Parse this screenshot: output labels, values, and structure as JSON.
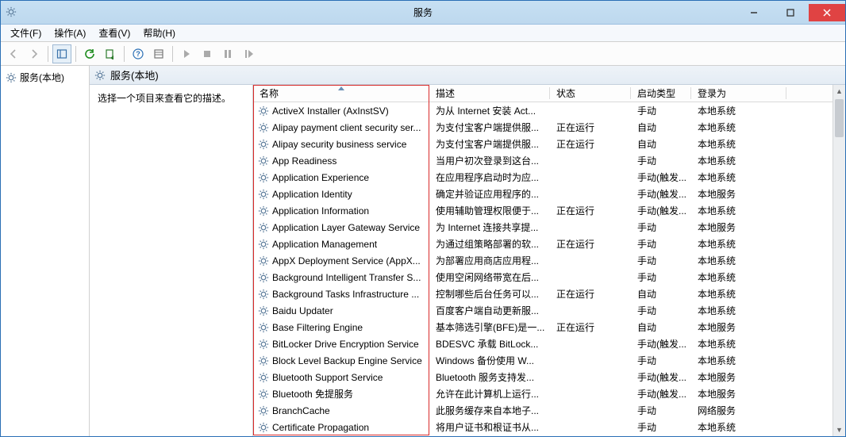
{
  "window": {
    "title": "服务",
    "icon": "gear-icon"
  },
  "menubar": {
    "file": "文件(F)",
    "action": "操作(A)",
    "view": "查看(V)",
    "help": "帮助(H)"
  },
  "tree": {
    "root": "服务(本地)"
  },
  "main": {
    "header": "服务(本地)",
    "desc_prompt": "选择一个项目来查看它的描述。"
  },
  "columns": {
    "name": "名称",
    "desc": "描述",
    "status": "状态",
    "startup": "启动类型",
    "logon": "登录为"
  },
  "col_widths": {
    "name": 222,
    "desc": 152,
    "status": 102,
    "startup": 76,
    "logon": 120
  },
  "services": [
    {
      "name": "ActiveX Installer (AxInstSV)",
      "desc": "为从 Internet 安装 Act...",
      "status": "",
      "startup": "手动",
      "logon": "本地系统"
    },
    {
      "name": "Alipay payment client security ser...",
      "desc": "为支付宝客户端提供服...",
      "status": "正在运行",
      "startup": "自动",
      "logon": "本地系统"
    },
    {
      "name": "Alipay security business service",
      "desc": "为支付宝客户端提供服...",
      "status": "正在运行",
      "startup": "自动",
      "logon": "本地系统"
    },
    {
      "name": "App Readiness",
      "desc": "当用户初次登录到这台...",
      "status": "",
      "startup": "手动",
      "logon": "本地系统"
    },
    {
      "name": "Application Experience",
      "desc": "在应用程序启动时为应...",
      "status": "",
      "startup": "手动(触发...",
      "logon": "本地系统"
    },
    {
      "name": "Application Identity",
      "desc": "确定并验证应用程序的...",
      "status": "",
      "startup": "手动(触发...",
      "logon": "本地服务"
    },
    {
      "name": "Application Information",
      "desc": "使用辅助管理权限便于...",
      "status": "正在运行",
      "startup": "手动(触发...",
      "logon": "本地系统"
    },
    {
      "name": "Application Layer Gateway Service",
      "desc": "为 Internet 连接共享提...",
      "status": "",
      "startup": "手动",
      "logon": "本地服务"
    },
    {
      "name": "Application Management",
      "desc": "为通过组策略部署的软...",
      "status": "正在运行",
      "startup": "手动",
      "logon": "本地系统"
    },
    {
      "name": "AppX Deployment Service (AppX...",
      "desc": "为部署应用商店应用程...",
      "status": "",
      "startup": "手动",
      "logon": "本地系统"
    },
    {
      "name": "Background Intelligent Transfer S...",
      "desc": "使用空闲网络带宽在后...",
      "status": "",
      "startup": "手动",
      "logon": "本地系统"
    },
    {
      "name": "Background Tasks Infrastructure ...",
      "desc": "控制哪些后台任务可以...",
      "status": "正在运行",
      "startup": "自动",
      "logon": "本地系统"
    },
    {
      "name": "Baidu Updater",
      "desc": "百度客户端自动更新服...",
      "status": "",
      "startup": "手动",
      "logon": "本地系统"
    },
    {
      "name": "Base Filtering Engine",
      "desc": "基本筛选引擎(BFE)是一...",
      "status": "正在运行",
      "startup": "自动",
      "logon": "本地服务"
    },
    {
      "name": "BitLocker Drive Encryption Service",
      "desc": "BDESVC 承载 BitLock...",
      "status": "",
      "startup": "手动(触发...",
      "logon": "本地系统"
    },
    {
      "name": "Block Level Backup Engine Service",
      "desc": "Windows 备份使用 W...",
      "status": "",
      "startup": "手动",
      "logon": "本地系统"
    },
    {
      "name": "Bluetooth Support Service",
      "desc": "Bluetooth 服务支持发...",
      "status": "",
      "startup": "手动(触发...",
      "logon": "本地服务"
    },
    {
      "name": "Bluetooth 免提服务",
      "desc": "允许在此计算机上运行...",
      "status": "",
      "startup": "手动(触发...",
      "logon": "本地服务"
    },
    {
      "name": "BranchCache",
      "desc": "此服务缓存来自本地子...",
      "status": "",
      "startup": "手动",
      "logon": "网络服务"
    },
    {
      "name": "Certificate Propagation",
      "desc": "将用户证书和根证书从...",
      "status": "",
      "startup": "手动",
      "logon": "本地系统"
    }
  ]
}
